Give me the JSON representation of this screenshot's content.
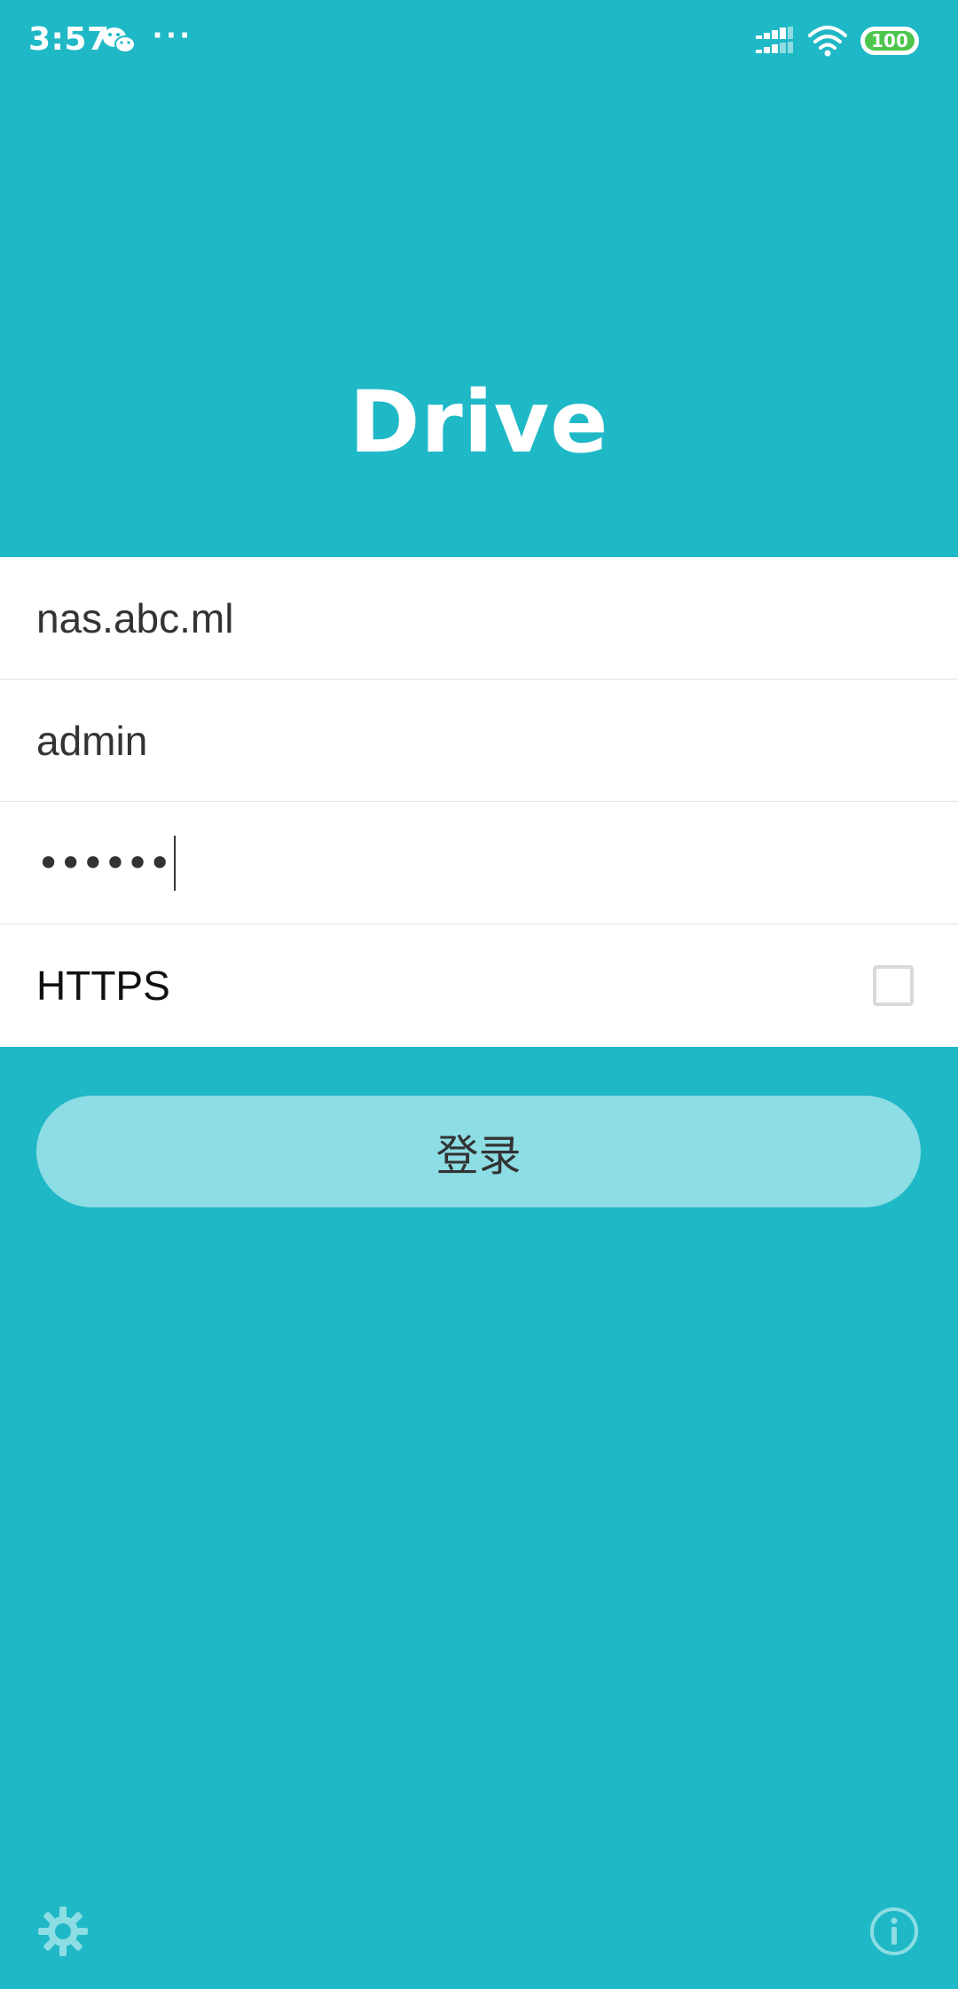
{
  "status_bar": {
    "time": "3:57",
    "more": "···",
    "battery": "100",
    "icons": [
      "wechat-icon",
      "signal-icon",
      "wifi-icon",
      "battery-icon"
    ]
  },
  "app": {
    "title": "Drive"
  },
  "form": {
    "server": "nas.abc.ml",
    "username": "admin",
    "password_mask": "••••••",
    "https_label": "HTTPS",
    "https_checked": false
  },
  "login": {
    "label": "登录"
  },
  "footer": {
    "icons": [
      "settings-icon",
      "info-icon"
    ]
  },
  "colors": {
    "background": "#1fb8c6",
    "button": "#8ddde4",
    "battery": "#4cc64c"
  }
}
